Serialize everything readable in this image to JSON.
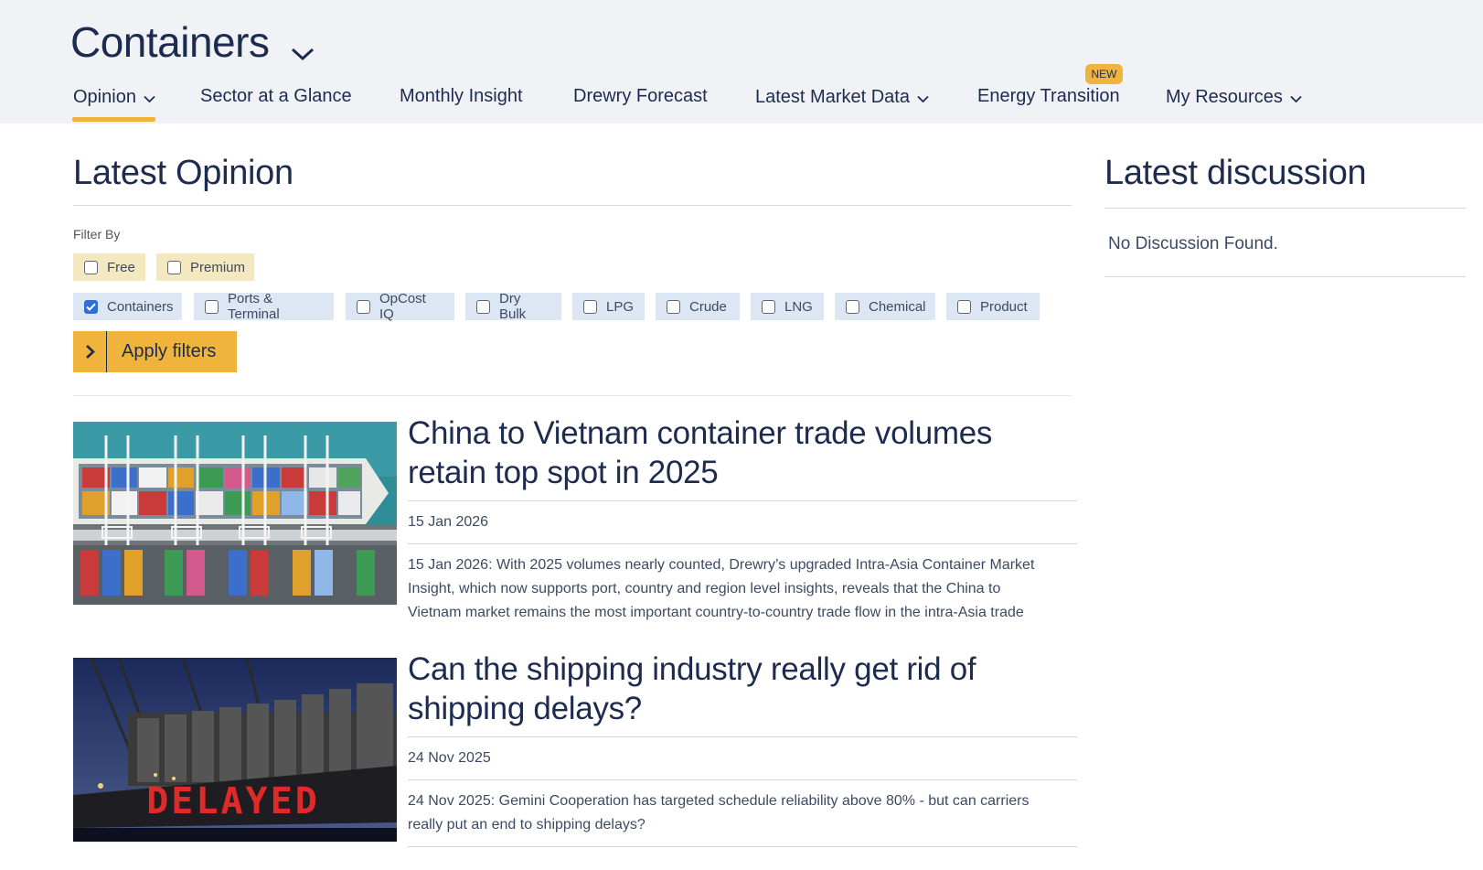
{
  "header": {
    "section_title": "Containers",
    "nav": [
      {
        "label": "Opinion",
        "has_dropdown": true,
        "active": true
      },
      {
        "label": "Sector at a Glance",
        "has_dropdown": false
      },
      {
        "label": "Monthly Insight",
        "has_dropdown": false
      },
      {
        "label": "Drewry Forecast",
        "has_dropdown": false
      },
      {
        "label": "Latest Market Data",
        "has_dropdown": true
      },
      {
        "label": "Energy Transition",
        "has_dropdown": false,
        "badge": "NEW"
      },
      {
        "label": "My Resources",
        "has_dropdown": true
      }
    ]
  },
  "main": {
    "heading": "Latest Opinion",
    "filter_label": "Filter By",
    "tier_filters": [
      {
        "label": "Free",
        "checked": false
      },
      {
        "label": "Premium",
        "checked": false
      }
    ],
    "sector_filters": [
      {
        "label": "Containers",
        "checked": true
      },
      {
        "label": "Ports & Terminal",
        "checked": false
      },
      {
        "label": "OpCost IQ",
        "checked": false
      },
      {
        "label": "Dry Bulk",
        "checked": false
      },
      {
        "label": "LPG",
        "checked": false
      },
      {
        "label": "Crude",
        "checked": false
      },
      {
        "label": "LNG",
        "checked": false
      },
      {
        "label": "Chemical",
        "checked": false
      },
      {
        "label": "Product",
        "checked": false
      }
    ],
    "apply_label": "Apply filters",
    "articles": [
      {
        "title_line1": "China to Vietnam container trade volumes",
        "title_line2": "retain top spot in 2025",
        "date": "15 Jan 2026",
        "excerpt_line1": "15 Jan 2026: With 2025 volumes nearly counted, Drewry’s upgraded Intra-Asia Container Market",
        "excerpt_line2": "Insight, which now supports port, country and region level insights, reveals that the China to",
        "excerpt_line3": "Vietnam market remains the most important country-to-country trade flow in the intra-Asia trade"
      },
      {
        "title_line1": "Can the shipping industry really get rid of",
        "title_line2": "shipping delays?",
        "date": "24 Nov 2025",
        "excerpt_line1": "24 Nov 2025: Gemini Cooperation has targeted schedule reliability above 80% - but can carriers",
        "excerpt_line2": "really put an end to shipping delays?",
        "image_text": "DELAYED"
      }
    ]
  },
  "sidebar": {
    "heading": "Latest discussion",
    "empty_text": "No Discussion Found."
  },
  "colors": {
    "navy": "#1d2b4f",
    "accent": "#f0b43c",
    "header_bg": "#f0f2f6",
    "tier_chip_bg": "#f3e8bf",
    "sector_chip_bg": "#dde6f3",
    "checkbox_checked": "#2f6fd3"
  },
  "icons": {
    "section_dropdown": "chevron-down-icon",
    "nav_dropdown": "chevron-down-icon",
    "apply": "chevron-right-icon",
    "checkbox_checked": "check-icon"
  }
}
